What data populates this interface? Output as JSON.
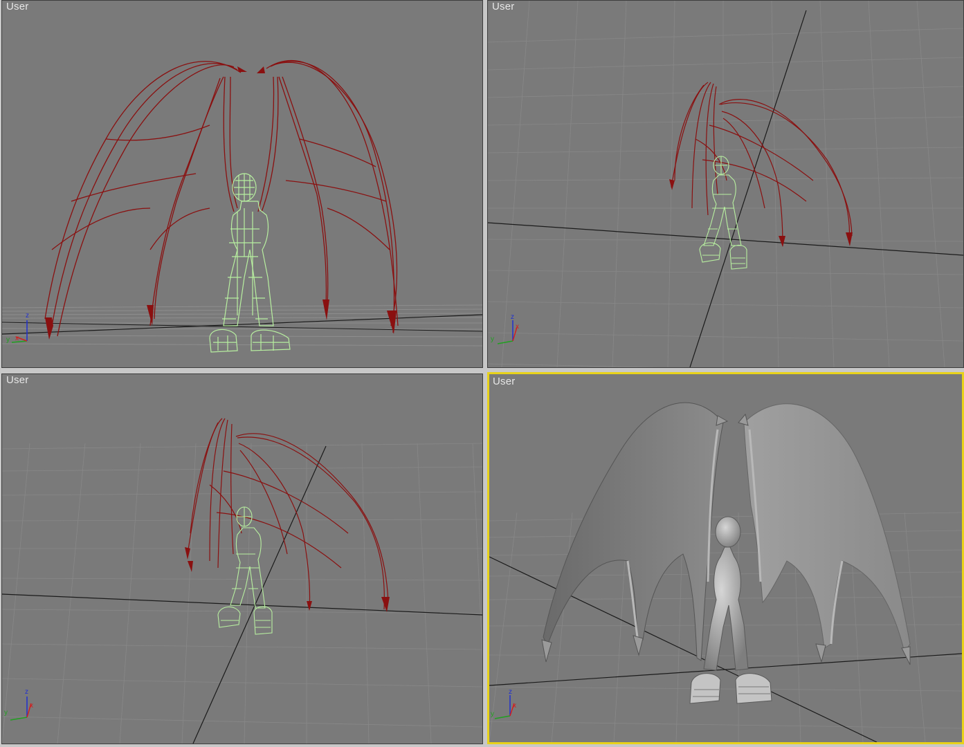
{
  "viewports": [
    {
      "id": "top-left",
      "label": "User",
      "active": false,
      "shading": "wireframe"
    },
    {
      "id": "top-right",
      "label": "User",
      "active": false,
      "shading": "wireframe"
    },
    {
      "id": "bottom-left",
      "label": "User",
      "active": false,
      "shading": "wireframe"
    },
    {
      "id": "bottom-right",
      "label": "User",
      "active": true,
      "shading": "smooth"
    }
  ],
  "axis_gizmo": {
    "x": "x",
    "y": "y",
    "z": "z"
  },
  "colors": {
    "viewport_bg": "#7a7a7a",
    "grid": "#8c8c8c",
    "wing_wire": "#8a1010",
    "body_wire": "#b8f0a0",
    "active_border": "#e8d21a",
    "axis_x": "#d02020",
    "axis_y": "#20a020",
    "axis_z": "#2030d0"
  }
}
